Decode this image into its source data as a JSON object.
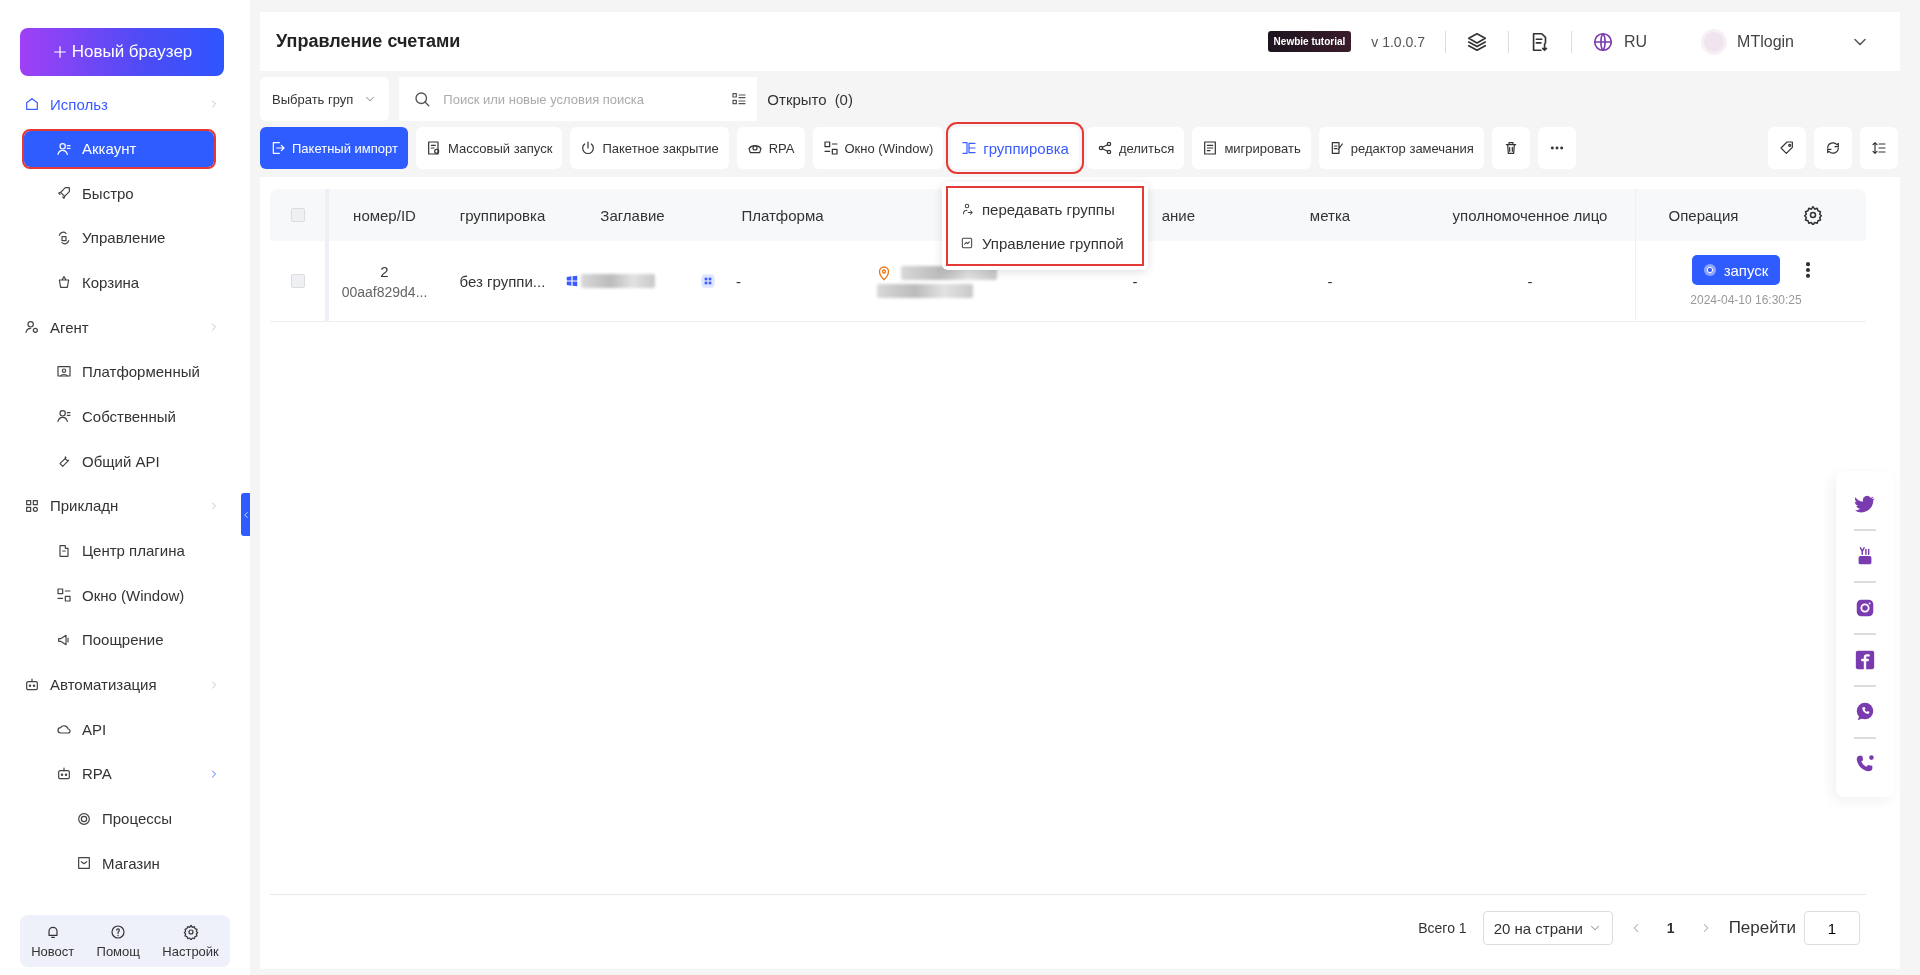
{
  "sidebar": {
    "new_button": "Новый браузер",
    "sections": [
      {
        "label": "Использ",
        "selected": true,
        "children": [
          {
            "label": "Аккаунт",
            "selected": true,
            "highlighted": true
          },
          {
            "label": "Быстро",
            "selected": false,
            "highlighted": false
          },
          {
            "label": "Управление",
            "selected": false,
            "highlighted": false
          },
          {
            "label": "Корзина",
            "selected": false,
            "highlighted": false
          }
        ]
      },
      {
        "label": "Агент",
        "selected": false,
        "children": [
          {
            "label": "Платформенный",
            "selected": false,
            "highlighted": false
          },
          {
            "label": "Собственный",
            "selected": false,
            "highlighted": false
          },
          {
            "label": "Общий API",
            "selected": false,
            "highlighted": false
          }
        ]
      },
      {
        "label": "Прикладн",
        "selected": false,
        "children": [
          {
            "label": "Центр плагина",
            "selected": false,
            "highlighted": false
          },
          {
            "label": "Окно (Window)",
            "selected": false,
            "highlighted": false
          },
          {
            "label": "Поощрение",
            "selected": false,
            "highlighted": false
          }
        ]
      },
      {
        "label": "Автоматизация",
        "selected": false,
        "children": [
          {
            "label": "API",
            "selected": false,
            "highlighted": false
          },
          {
            "label": "RPA",
            "selected": false,
            "highlighted": false,
            "children": [
              {
                "label": "Процессы",
                "selected": false,
                "highlighted": false
              },
              {
                "label": "Магазин",
                "selected": false,
                "highlighted": false
              }
            ]
          }
        ]
      }
    ],
    "footer": [
      {
        "label": "Новост"
      },
      {
        "label": "Помощ"
      },
      {
        "label": "Настройк"
      }
    ]
  },
  "header": {
    "title": "Управление счетами",
    "tutorial_badge": "Newbie tutorial",
    "version": "v 1.0.0.7",
    "language": "RU",
    "user": "MTlogin"
  },
  "filters": {
    "group_select": "Выбрать груп",
    "search": {
      "placeholder": "Поиск или новые условия поиска"
    },
    "open_label": "Открыто",
    "open_count": "(0)"
  },
  "toolbar": [
    {
      "label": "Пакетный импорт",
      "kind": "primary",
      "open": false,
      "highlighted": false
    },
    {
      "label": "Массовый запуск",
      "kind": "default",
      "open": false,
      "highlighted": false
    },
    {
      "label": "Пакетное закрытие",
      "kind": "default",
      "open": false,
      "highlighted": false
    },
    {
      "label": "RPA",
      "kind": "default",
      "open": false,
      "highlighted": false
    },
    {
      "label": "Окно (Window)",
      "kind": "default",
      "open": false,
      "highlighted": false
    },
    {
      "label": "группировка",
      "kind": "default",
      "open": true,
      "highlighted": true
    },
    {
      "label": "делиться",
      "kind": "default",
      "open": false,
      "highlighted": false
    },
    {
      "label": "мигрировать",
      "kind": "default",
      "open": false,
      "highlighted": false
    },
    {
      "label": "редактор замечания",
      "kind": "default",
      "open": false,
      "highlighted": false
    }
  ],
  "group_menu": {
    "highlighted": true,
    "items": [
      {
        "label": "передавать группы"
      },
      {
        "label": "Управление группой"
      }
    ]
  },
  "table": {
    "all_selected": false,
    "columns": [
      "номер/ID",
      "группировка",
      "Заглавие",
      "Платформа",
      "ание",
      "метка",
      "уполномоченное лицо",
      "Операция"
    ],
    "rows": [
      {
        "selected": false,
        "number": "2",
        "id": "00aaf829d4...",
        "group": "без группи...",
        "title_redacted": true,
        "platform": "-",
        "address_redacted": true,
        "column_6": "-",
        "tag": "-",
        "authorized": "-",
        "launch": "запуск",
        "time": "2024-04-10 16:30:25"
      }
    ]
  },
  "pagination": {
    "total": "Всего 1",
    "page_size": "20 на страни",
    "pages": [
      {
        "label": "1",
        "selected": true
      }
    ],
    "goto_label": "Перейти",
    "goto_value": "1"
  }
}
